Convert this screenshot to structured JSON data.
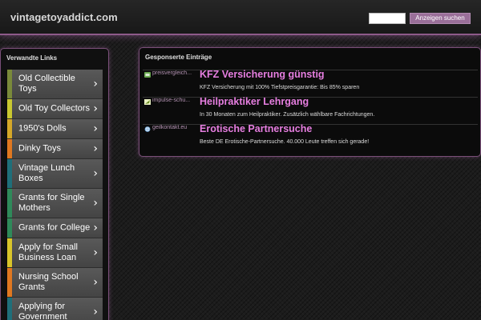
{
  "header": {
    "site_title": "vintagetoyaddict.com",
    "search_placeholder": "",
    "search_button": "Anzeigen suchen"
  },
  "sidebar": {
    "title": "Verwandte Links",
    "items": [
      {
        "label": "Old Collectible Toys",
        "color": "#7a8a3a"
      },
      {
        "label": "Old Toy Collectors",
        "color": "#c9c830"
      },
      {
        "label": "1950's Dolls",
        "color": "#d5a828"
      },
      {
        "label": "Dinky Toys",
        "color": "#e07820"
      },
      {
        "label": "Vintage Lunch Boxes",
        "color": "#1f6f7a"
      },
      {
        "label": "Grants for Single Mothers",
        "color": "#2f8a5a"
      },
      {
        "label": "Grants for College",
        "color": "#2f8a5a"
      },
      {
        "label": "Apply for Small Business Loan",
        "color": "#d9c52a"
      },
      {
        "label": "Nursing School Grants",
        "color": "#e07820"
      },
      {
        "label": "Applying for Government",
        "color": "#1f6f7a"
      }
    ]
  },
  "sponsored": {
    "title": "Gesponserte Einträge",
    "ads": [
      {
        "domain": "preisvergleich...",
        "headline": "KFZ Versicherung günstig",
        "description": "KFZ Versicherung mit 100% Tiefstpreisgarantie: Bis 85% sparen",
        "favicon_icon": "price-tag-icon"
      },
      {
        "domain": "impulse-schu...",
        "headline": "Heilpraktiker Lehrgang",
        "description": "In 30 Monaten zum Heilpraktiker. Zusätzlich wählbare Fachrichtungen.",
        "favicon_icon": "leaf-icon"
      },
      {
        "domain": "geilkontakt.eu",
        "headline": "Erotische Partnersuche",
        "description": "Beste DE Erotische-Partnersuche. 40.000 Leute treffen sich gerade!",
        "favicon_icon": "globe-icon"
      }
    ]
  },
  "colors": {
    "accent_border": "#8e5a8a",
    "ad_headline": "#e67ee0",
    "search_button_bg": "#9a6f99"
  }
}
